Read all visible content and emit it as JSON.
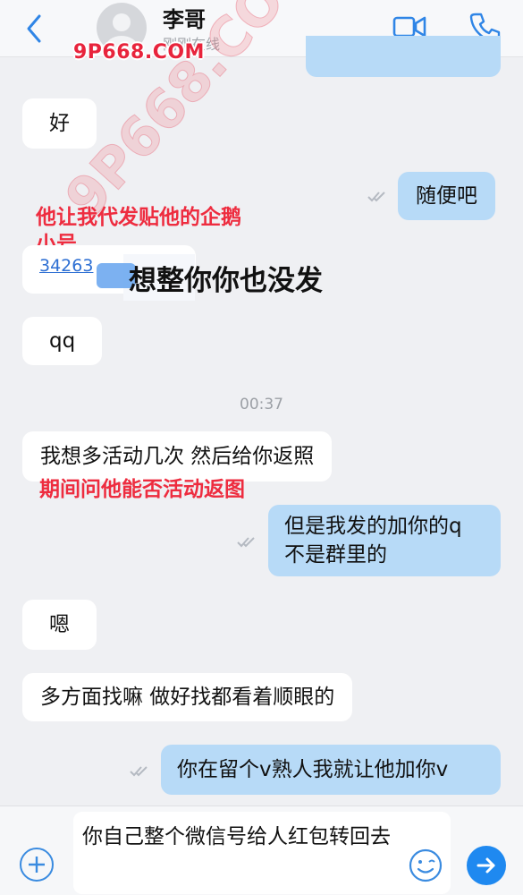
{
  "header": {
    "contact_name": "李哥",
    "contact_status": "刚刚在线"
  },
  "watermark": {
    "top": "9P668.COM",
    "diagonal": "9P668.COM"
  },
  "messages": [
    {
      "side": "received",
      "text": "好"
    },
    {
      "side": "sent",
      "text": "随便吧"
    },
    {
      "side": "received",
      "text": "34263"
    },
    {
      "side": "received",
      "text": "qq"
    },
    {
      "side": "received",
      "text": "我想多活动几次 然后给你返照"
    },
    {
      "side": "sent",
      "lines": [
        "但是我发的加你的q",
        "不是群里的"
      ]
    },
    {
      "side": "received",
      "text": "嗯"
    },
    {
      "side": "received",
      "text": "多方面找嘛 做好找都看着顺眼的"
    },
    {
      "side": "sent",
      "text": "你在留个v熟人我就让他加你v"
    }
  ],
  "timestamp": "00:37",
  "annotations": {
    "a1_line1": "他让我代发贴他的企鹅",
    "a1_line2": "小号",
    "a2": "想整你你也没发",
    "a3": "期间问他能否活动返图"
  },
  "composer": {
    "text": "你自己整个微信号给人红包转回去"
  },
  "colors": {
    "sent_bubble": "#b7daf7",
    "received_bubble": "#ffffff",
    "accent": "#1f89f0",
    "annotation": "#ee2c3f"
  },
  "icons": [
    "back-icon",
    "video-call-icon",
    "phone-icon",
    "read-tick-icon",
    "plus-icon",
    "emoji-icon",
    "send-arrow-icon"
  ]
}
